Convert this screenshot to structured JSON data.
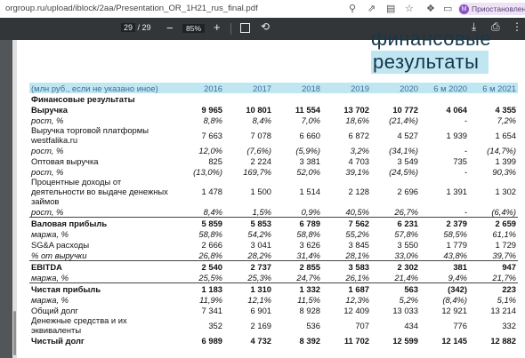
{
  "browser": {
    "url": "orgroup.ru/upload/iblock/2aa/Presentation_OR_1H21_rus_final.pdf",
    "profile_initial": "M",
    "profile_label": "Приостановлена"
  },
  "pdf_toolbar": {
    "page_current": "29",
    "page_total": "/ 29",
    "zoom": "85%"
  },
  "slide": {
    "title_line1": "финансовые",
    "title_line2": "результаты"
  },
  "table": {
    "header": [
      "(млн руб., если не указано иное)",
      "2016",
      "2017",
      "2018",
      "2019",
      "2020",
      "6 м 2020",
      "6 м 2021"
    ],
    "rows": [
      {
        "label": "Финансовые результаты",
        "values": [
          "",
          "",
          "",
          "",
          "",
          "",
          ""
        ],
        "style": "section"
      },
      {
        "label": "Выручка",
        "values": [
          "9 965",
          "10 801",
          "11 554",
          "13 702",
          "10 772",
          "4 064",
          "4 355"
        ],
        "style": "bold"
      },
      {
        "label": "рост, %",
        "values": [
          "8,8%",
          "8,4%",
          "7,0%",
          "18,6%",
          "(21,4%)",
          "-",
          "7,2%"
        ],
        "style": "it"
      },
      {
        "label": "Выручка торговой платформы westfalika.ru",
        "values": [
          "7 663",
          "7 078",
          "6 660",
          "6 872",
          "4 527",
          "1 939",
          "1 654"
        ],
        "style": "sub"
      },
      {
        "label": "рост, %",
        "values": [
          "12,0%",
          "(7,6%)",
          "(5,9%)",
          "3,2%",
          "(34,1%)",
          "-",
          "(14,7%)"
        ],
        "style": "it"
      },
      {
        "label": "Оптовая выручка",
        "values": [
          "825",
          "2 224",
          "3 381",
          "4 703",
          "3 549",
          "735",
          "1 399"
        ],
        "style": "sub"
      },
      {
        "label": "рост, %",
        "values": [
          "(13,0%)",
          "169,7%",
          "52,0%",
          "39,1%",
          "(24,5%)",
          "-",
          "90,3%"
        ],
        "style": "it"
      },
      {
        "label": "Процентные доходы от деятельности во выдаче денежных займов",
        "values": [
          "1 478",
          "1 500",
          "1 514",
          "2 128",
          "2 696",
          "1 391",
          "1 302"
        ],
        "style": "sub"
      },
      {
        "label": "рост, %",
        "values": [
          "8,4%",
          "1,5%",
          "0,9%",
          "40,5%",
          "26,7%",
          "-",
          "(6,4%)"
        ],
        "style": "it bb"
      },
      {
        "label": "Валовая прибыль",
        "values": [
          "5 859",
          "5 853",
          "6 789",
          "7 562",
          "6 231",
          "2 379",
          "2 659"
        ],
        "style": "bold"
      },
      {
        "label": "маржа, %",
        "values": [
          "58,8%",
          "54,2%",
          "58,8%",
          "55,2%",
          "57,8%",
          "58,5%",
          "61,1%"
        ],
        "style": "it"
      },
      {
        "label": "SG&A расходы",
        "values": [
          "2 666",
          "3 041",
          "3 626",
          "3 845",
          "3 550",
          "1 779",
          "1 729"
        ],
        "style": ""
      },
      {
        "label": "% от выручки",
        "values": [
          "26,8%",
          "28,2%",
          "31,4%",
          "28,1%",
          "33,0%",
          "43,8%",
          "39,7%"
        ],
        "style": "it bb"
      },
      {
        "label": "EBITDA",
        "values": [
          "2 540",
          "2 737",
          "2 855",
          "3 583",
          "2 302",
          "381",
          "947"
        ],
        "style": "bold"
      },
      {
        "label": "маржа, %",
        "values": [
          "25,5%",
          "25,3%",
          "24,7%",
          "26,1%",
          "21,4%",
          "9,4%",
          "21,7%"
        ],
        "style": "it bb"
      },
      {
        "label": "Чистая прибыль",
        "values": [
          "1 183",
          "1 310",
          "1 332",
          "1 687",
          "563",
          "(342)",
          "223"
        ],
        "style": "bold"
      },
      {
        "label": "маржа, %",
        "values": [
          "11,9%",
          "12,1%",
          "11,5%",
          "12,3%",
          "5,2%",
          "(8,4%)",
          "5,1%"
        ],
        "style": "it"
      },
      {
        "label": "Общий долг",
        "values": [
          "7 341",
          "6 901",
          "8 928",
          "12 409",
          "13 033",
          "12 921",
          "13 214"
        ],
        "style": ""
      },
      {
        "label": "Денежные средства и их эквиваленты",
        "values": [
          "352",
          "2 169",
          "536",
          "707",
          "434",
          "776",
          "332"
        ],
        "style": ""
      },
      {
        "label": "Чистый долг",
        "values": [
          "6 989",
          "4 732",
          "8 392",
          "11 702",
          "12 599",
          "12 145",
          "12 882"
        ],
        "style": "bold"
      }
    ]
  }
}
